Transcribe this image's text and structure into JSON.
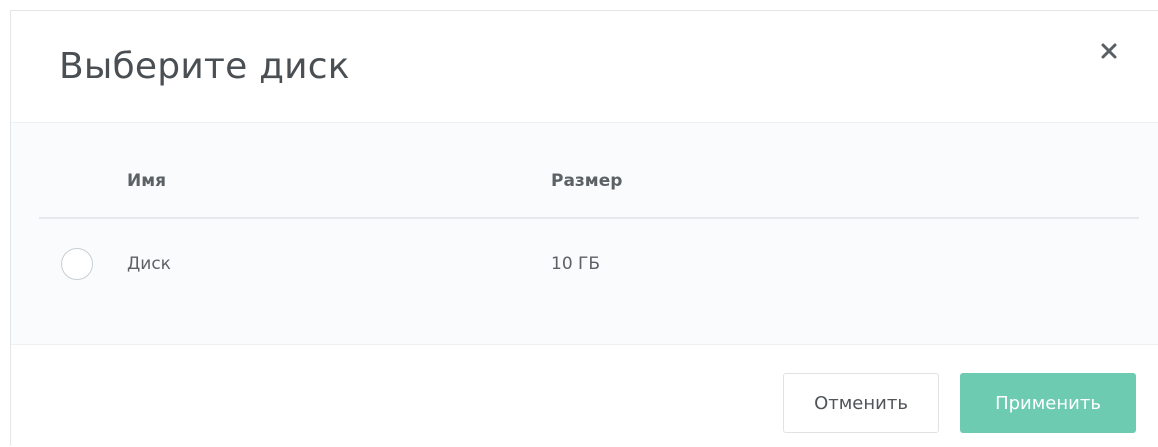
{
  "dialog": {
    "title": "Выберите диск",
    "close_icon": "close-icon"
  },
  "table": {
    "columns": [
      "Имя",
      "Размер"
    ],
    "rows": [
      {
        "name": "Диск",
        "size": "10 ГБ",
        "selected": false
      }
    ]
  },
  "footer": {
    "cancel_label": "Отменить",
    "apply_label": "Применить"
  },
  "colors": {
    "primary": "#6ccbb0",
    "text": "#5c6166",
    "title": "#4a4f54"
  }
}
